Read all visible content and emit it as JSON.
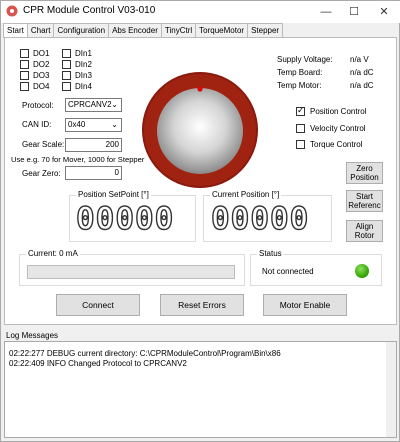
{
  "window": {
    "title": "CPR Module Control V03-010"
  },
  "tabs": [
    "Start",
    "Chart",
    "Configuration",
    "Abs Encoder",
    "TinyCtrl",
    "TorqueMotor",
    "Stepper"
  ],
  "outputs": [
    {
      "label": "DO1",
      "checked": false
    },
    {
      "label": "DO2",
      "checked": false
    },
    {
      "label": "DO3",
      "checked": false
    },
    {
      "label": "DO4",
      "checked": false
    }
  ],
  "inputs": [
    {
      "label": "DIn1",
      "checked": false
    },
    {
      "label": "DIn2",
      "checked": false
    },
    {
      "label": "DIn3",
      "checked": false
    },
    {
      "label": "DIn4",
      "checked": false
    }
  ],
  "protocol": {
    "label": "Protocol:",
    "value": "CPRCANV2"
  },
  "can_id": {
    "label": "CAN ID:",
    "value": "0x40"
  },
  "gear_scale": {
    "label": "Gear Scale:",
    "value": "200",
    "hint": "Use e.g. 70 for Mover, 1000 for Stepper"
  },
  "gear_zero": {
    "label": "Gear Zero:",
    "value": "0"
  },
  "sensors": [
    {
      "label": "Supply Voltage:",
      "value": "n/a V"
    },
    {
      "label": "Temp Board:",
      "value": "n/a dC"
    },
    {
      "label": "Temp Motor:",
      "value": "n/a dC"
    }
  ],
  "control_modes": [
    {
      "label": "Position Control",
      "checked": true
    },
    {
      "label": "Velocity Control",
      "checked": false
    },
    {
      "label": "Torque Control",
      "checked": false
    }
  ],
  "side_buttons": {
    "zero": "Zero Position",
    "start_ref": "Start Referenc",
    "align": "Align Rotor"
  },
  "position_setpoint": {
    "title": "Position SetPoint [°]",
    "digits": "00000"
  },
  "current_position": {
    "title": "Current Position [°]",
    "digits": "00000"
  },
  "current": {
    "title": "Current: 0 mA"
  },
  "status": {
    "title": "Status",
    "text": "Not connected",
    "led_color": "#38a80a"
  },
  "buttons": {
    "connect": "Connect",
    "reset": "Reset Errors",
    "enable": "Motor Enable"
  },
  "log": {
    "title": "Log Messages",
    "lines": [
      "02:22:277  DEBUG current directory: C:\\CPRModuleControl\\Program\\Bin\\x86",
      "02:22:409  INFO     Changed Protocol to CPRCANV2"
    ]
  }
}
